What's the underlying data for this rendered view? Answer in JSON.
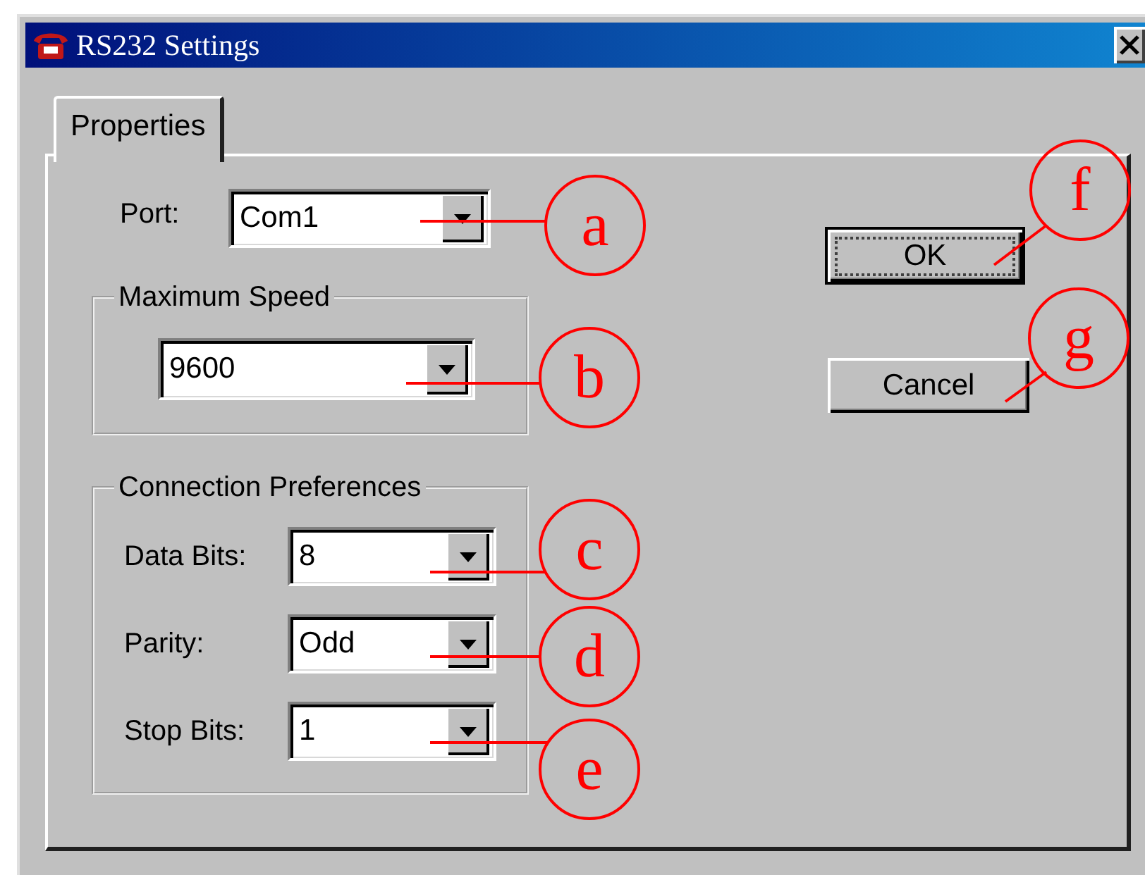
{
  "window": {
    "title": "RS232 Settings"
  },
  "tabs": [
    {
      "label": "Properties",
      "selected": true
    }
  ],
  "port": {
    "label": "Port:",
    "value": "Com1"
  },
  "maximum_speed": {
    "title": "Maximum Speed",
    "value": "9600"
  },
  "connection_preferences": {
    "title": "Connection Preferences",
    "fields": [
      {
        "label": "Data Bits:",
        "value": "8"
      },
      {
        "label": "Parity:",
        "value": "Odd"
      },
      {
        "label": "Stop Bits:",
        "value": "1"
      }
    ]
  },
  "buttons": [
    {
      "label": "OK",
      "default": true
    },
    {
      "label": "Cancel",
      "default": false
    }
  ],
  "callouts": [
    {
      "letter": "a"
    },
    {
      "letter": "b"
    },
    {
      "letter": "c"
    },
    {
      "letter": "d"
    },
    {
      "letter": "e"
    },
    {
      "letter": "f"
    },
    {
      "letter": "g"
    }
  ]
}
